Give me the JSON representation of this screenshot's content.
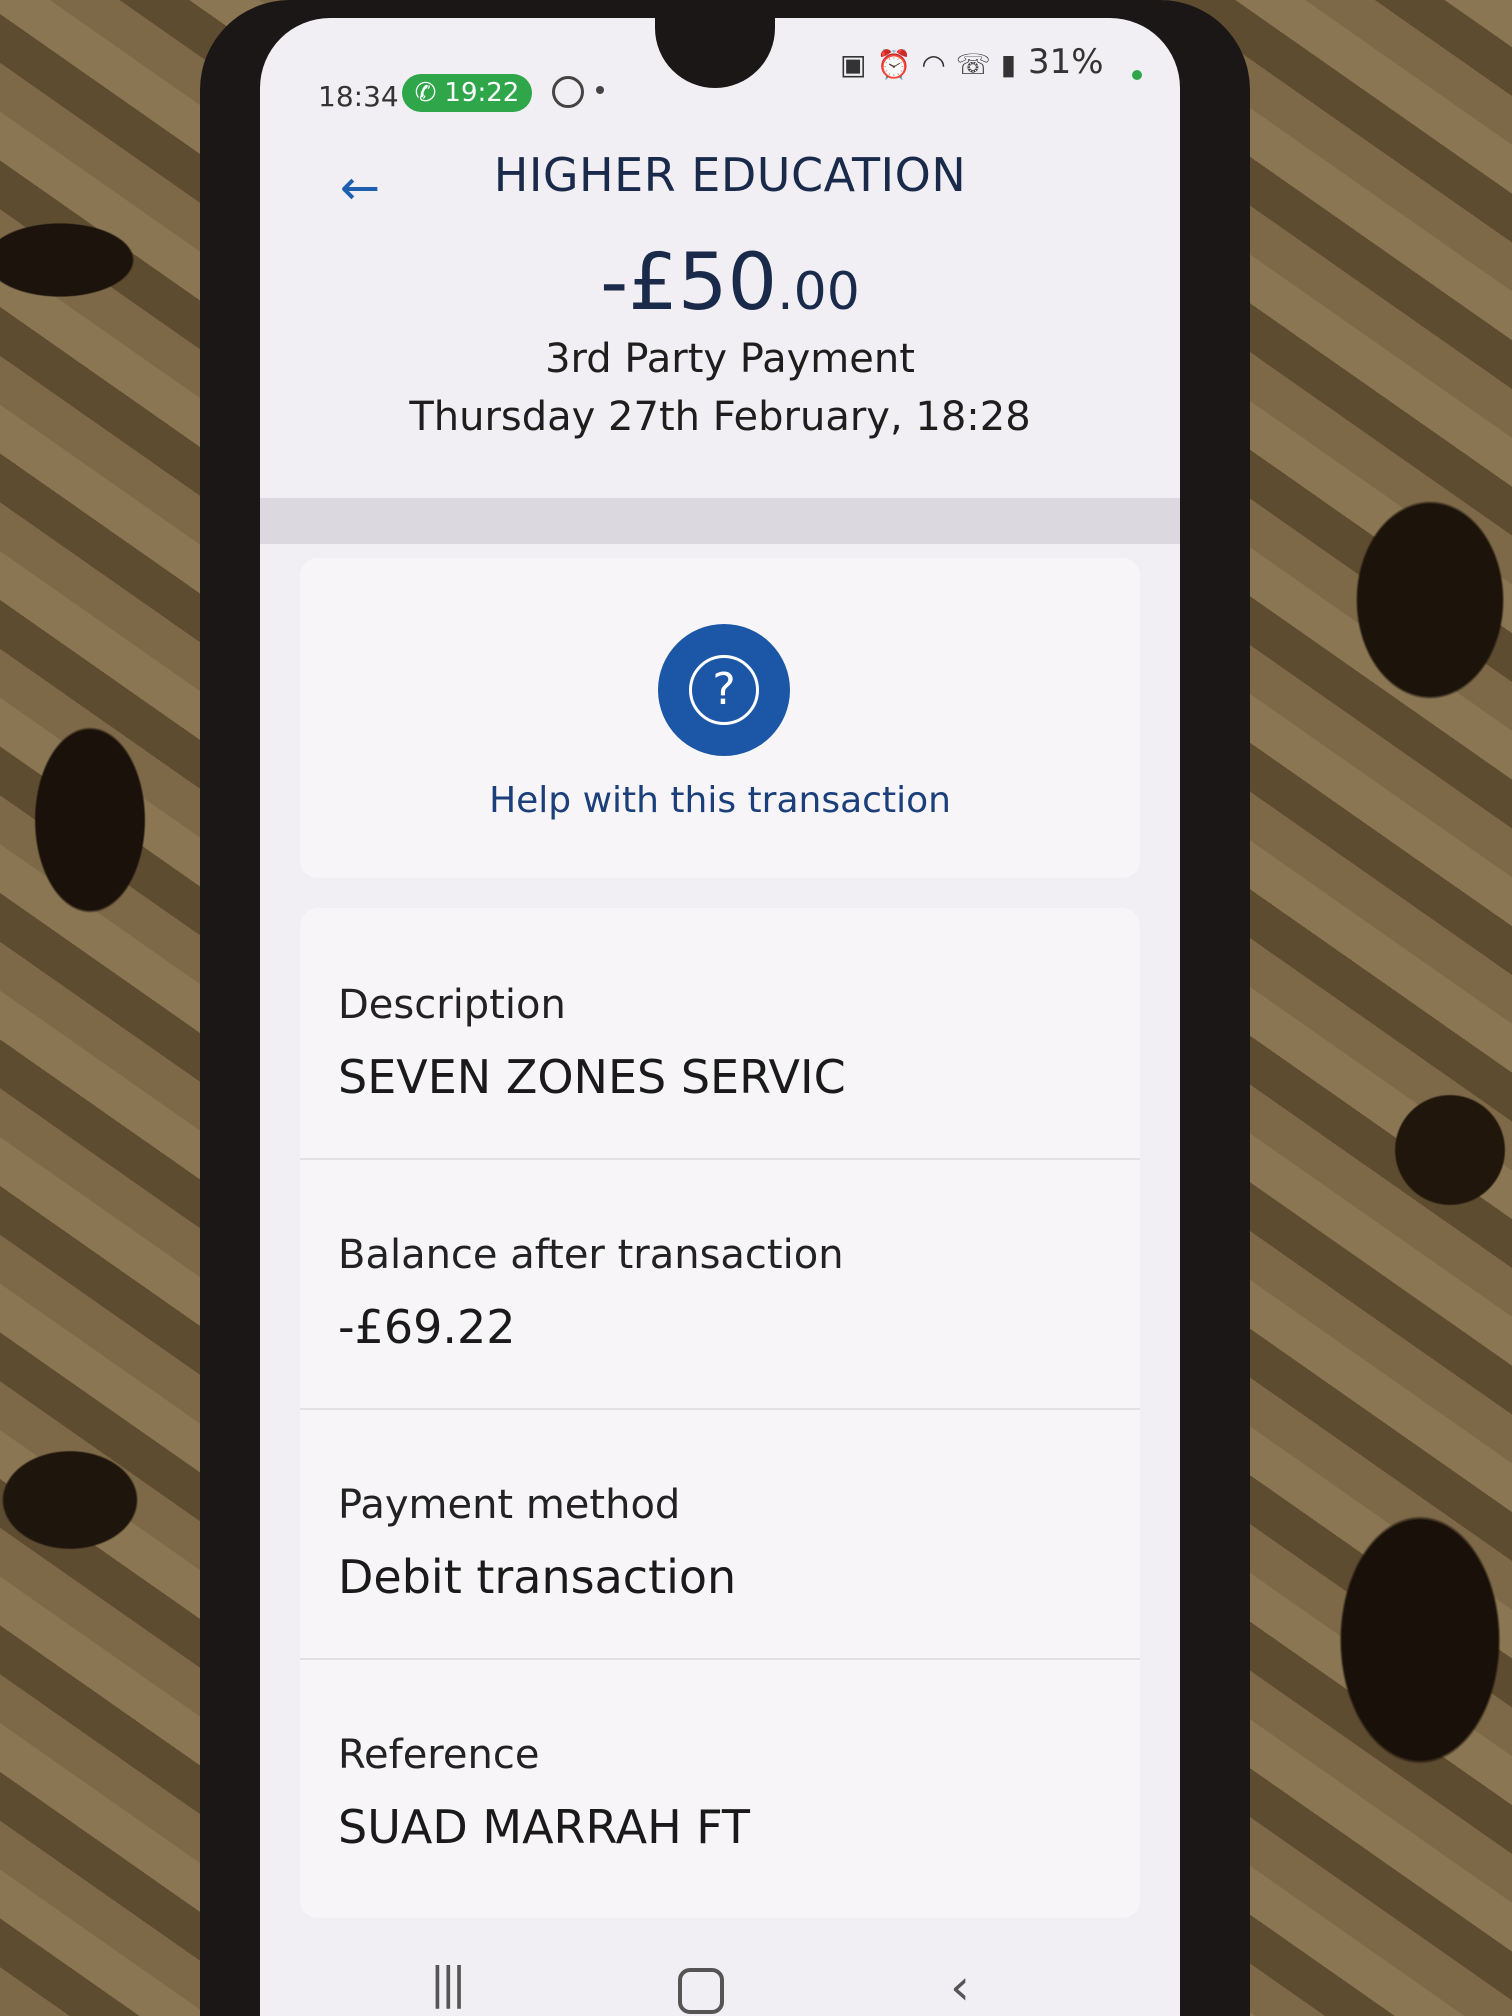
{
  "status_bar": {
    "time": "18:34",
    "call_time": "19:22",
    "battery": "31%"
  },
  "header": {
    "title": "HIGHER EDUCATION",
    "amount_main": "-£50",
    "amount_cents": ".00",
    "type": "3rd Party Payment",
    "datetime": "Thursday 27th February, 18:28"
  },
  "help": {
    "label": "Help with this transaction"
  },
  "details": [
    {
      "label": "Description",
      "value": "SEVEN ZONES SERVIC"
    },
    {
      "label": "Balance after transaction",
      "value": "-£69.22"
    },
    {
      "label": "Payment method",
      "value": "Debit transaction"
    },
    {
      "label": "Reference",
      "value": "SUAD MARRAH FT"
    }
  ],
  "colors": {
    "accent": "#1b57a6",
    "call_green": "#2fa64a",
    "title": "#1a2a4a"
  }
}
